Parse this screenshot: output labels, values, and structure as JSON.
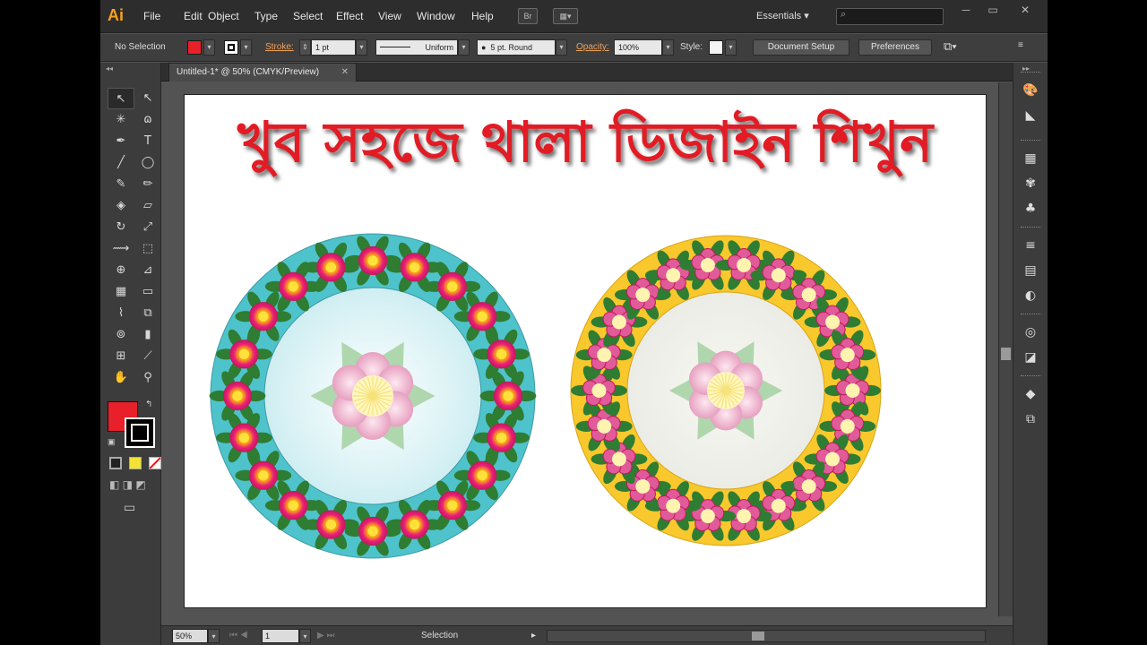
{
  "app": {
    "logo": "Ai"
  },
  "menu": [
    "File",
    "Edit",
    "Object",
    "Type",
    "Select",
    "Effect",
    "View",
    "Window",
    "Help"
  ],
  "menubar": {
    "bridge_label": "Br",
    "workspace": "Essentials",
    "workspace_arrow": "▾",
    "search_placeholder": "⌕"
  },
  "window_controls": {
    "minimize": "─",
    "restore": "▭",
    "close": "✕"
  },
  "control": {
    "selection_label": "No Selection",
    "stroke_label": "Stroke:",
    "stroke_weight": "1 pt",
    "profile": "Uniform",
    "brush": "5 pt. Round",
    "opacity_label": "Opacity:",
    "opacity_value": "100%",
    "style_label": "Style:",
    "document_setup": "Document Setup",
    "preferences": "Preferences",
    "fill_color": "#e8202a"
  },
  "document": {
    "tab_title": "Untitled-1* @ 50% (CMYK/Preview)",
    "close": "✕"
  },
  "artwork": {
    "title": "খুব সহজে থালা ডিজাইন শিখুন",
    "plate_left_color": "#4fc3cc",
    "plate_right_color": "#f9c82c"
  },
  "status": {
    "zoom": "50%",
    "page": "1",
    "tool": "Selection"
  },
  "tools": [
    {
      "name": "selection-tool",
      "glyph": "↖"
    },
    {
      "name": "direct-selection-tool",
      "glyph": "↖"
    },
    {
      "name": "magic-wand-tool",
      "glyph": "✳"
    },
    {
      "name": "lasso-tool",
      "glyph": "ɷ"
    },
    {
      "name": "pen-tool",
      "glyph": "✒"
    },
    {
      "name": "type-tool",
      "glyph": "T"
    },
    {
      "name": "line-tool",
      "glyph": "╱"
    },
    {
      "name": "ellipse-tool",
      "glyph": "◯"
    },
    {
      "name": "paintbrush-tool",
      "glyph": "✎"
    },
    {
      "name": "pencil-tool",
      "glyph": "✏"
    },
    {
      "name": "blob-brush-tool",
      "glyph": "◈"
    },
    {
      "name": "eraser-tool",
      "glyph": "▱"
    },
    {
      "name": "rotate-tool",
      "glyph": "↻"
    },
    {
      "name": "scale-tool",
      "glyph": "⤢"
    },
    {
      "name": "width-tool",
      "glyph": "⟿"
    },
    {
      "name": "free-transform-tool",
      "glyph": "⬚"
    },
    {
      "name": "shape-builder-tool",
      "glyph": "⊕"
    },
    {
      "name": "perspective-grid-tool",
      "glyph": "⊿"
    },
    {
      "name": "mesh-tool",
      "glyph": "▦"
    },
    {
      "name": "gradient-tool",
      "glyph": "▭"
    },
    {
      "name": "eyedropper-tool",
      "glyph": "⌇"
    },
    {
      "name": "blend-tool",
      "glyph": "⧉"
    },
    {
      "name": "symbol-sprayer-tool",
      "glyph": "⊚"
    },
    {
      "name": "column-graph-tool",
      "glyph": "▮"
    },
    {
      "name": "artboard-tool",
      "glyph": "⊞"
    },
    {
      "name": "slice-tool",
      "glyph": "⟋"
    },
    {
      "name": "hand-tool",
      "glyph": "✋"
    },
    {
      "name": "zoom-tool",
      "glyph": "⚲"
    }
  ],
  "dock": [
    "color-panel-icon",
    "color-guide-icon",
    "swatches-icon",
    "brushes-icon",
    "symbols-icon",
    "stroke-icon",
    "gradient-icon",
    "transparency-icon",
    "appearance-icon",
    "graphic-styles-icon",
    "layers-icon",
    "artboards-icon"
  ]
}
